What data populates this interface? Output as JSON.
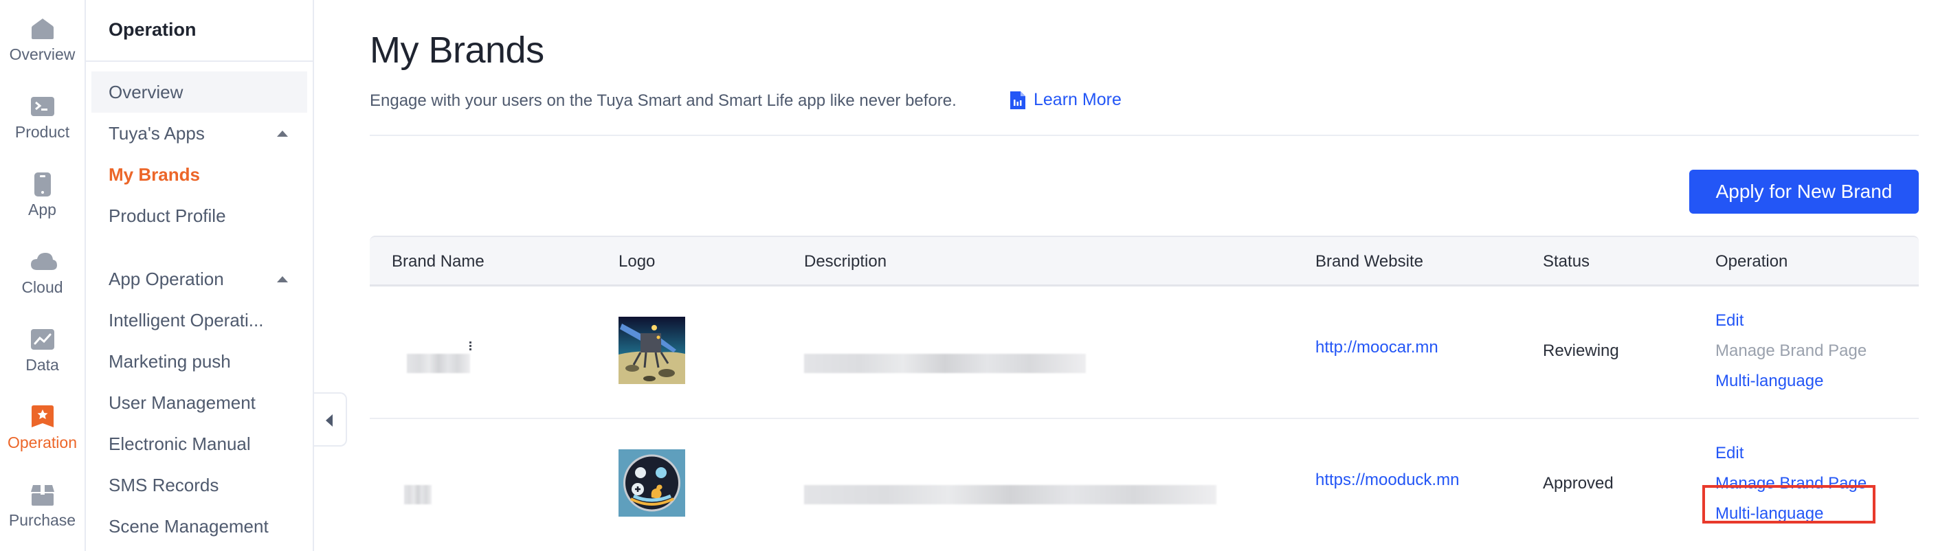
{
  "rail": {
    "items": [
      {
        "label": "Overview",
        "icon": "home-icon",
        "active": false
      },
      {
        "label": "Product",
        "icon": "terminal-icon",
        "active": false
      },
      {
        "label": "App",
        "icon": "phone-icon",
        "active": false
      },
      {
        "label": "Cloud",
        "icon": "cloud-icon",
        "active": false
      },
      {
        "label": "Data",
        "icon": "chart-icon",
        "active": false
      },
      {
        "label": "Operation",
        "icon": "star-bookmark-icon",
        "active": true
      },
      {
        "label": "Purchase",
        "icon": "box-icon",
        "active": false
      }
    ]
  },
  "menu": {
    "title": "Operation",
    "items": [
      {
        "label": "Overview",
        "type": "item"
      },
      {
        "label": "Tuya's Apps",
        "type": "group",
        "expanded": true
      },
      {
        "label": "My Brands",
        "type": "subitem",
        "active": true
      },
      {
        "label": "Product Profile",
        "type": "subitem"
      },
      {
        "label": "App Operation",
        "type": "group",
        "expanded": true
      },
      {
        "label": "Intelligent Operati...",
        "type": "subitem"
      },
      {
        "label": "Marketing push",
        "type": "subitem"
      },
      {
        "label": "User Management",
        "type": "subitem"
      },
      {
        "label": "Electronic Manual",
        "type": "subitem"
      },
      {
        "label": "SMS Records",
        "type": "subitem"
      },
      {
        "label": "Scene Management",
        "type": "subitem"
      }
    ]
  },
  "page": {
    "title": "My Brands",
    "description": "Engage with your users on the Tuya Smart and Smart Life app like never before.",
    "learn_more": "Learn More",
    "apply_button": "Apply for New Brand"
  },
  "colors": {
    "accent_orange": "#ec6629",
    "primary_blue": "#2356f6",
    "highlight_red": "#e83a2c"
  },
  "table": {
    "columns": [
      "Brand Name",
      "Logo",
      "Description",
      "Brand Website",
      "Status",
      "Operation"
    ],
    "rows": [
      {
        "brand_name": "[blurred]",
        "logo": "lunar-lander-image",
        "description": "[blurred]",
        "website": "http://moocar.mn",
        "status": "Reviewing",
        "operations": [
          {
            "label": "Edit",
            "enabled": true
          },
          {
            "label": "Manage Brand Page",
            "enabled": false
          },
          {
            "label": "Multi-language",
            "enabled": true
          }
        ]
      },
      {
        "brand_name": "[blurred]",
        "logo": "duck-badge-image",
        "description": "[blurred]",
        "website": "https://mooduck.mn",
        "status": "Approved",
        "operations": [
          {
            "label": "Edit",
            "enabled": true
          },
          {
            "label": "Manage Brand Page",
            "enabled": true,
            "highlighted": true
          },
          {
            "label": "Multi-language",
            "enabled": true
          }
        ]
      }
    ]
  }
}
